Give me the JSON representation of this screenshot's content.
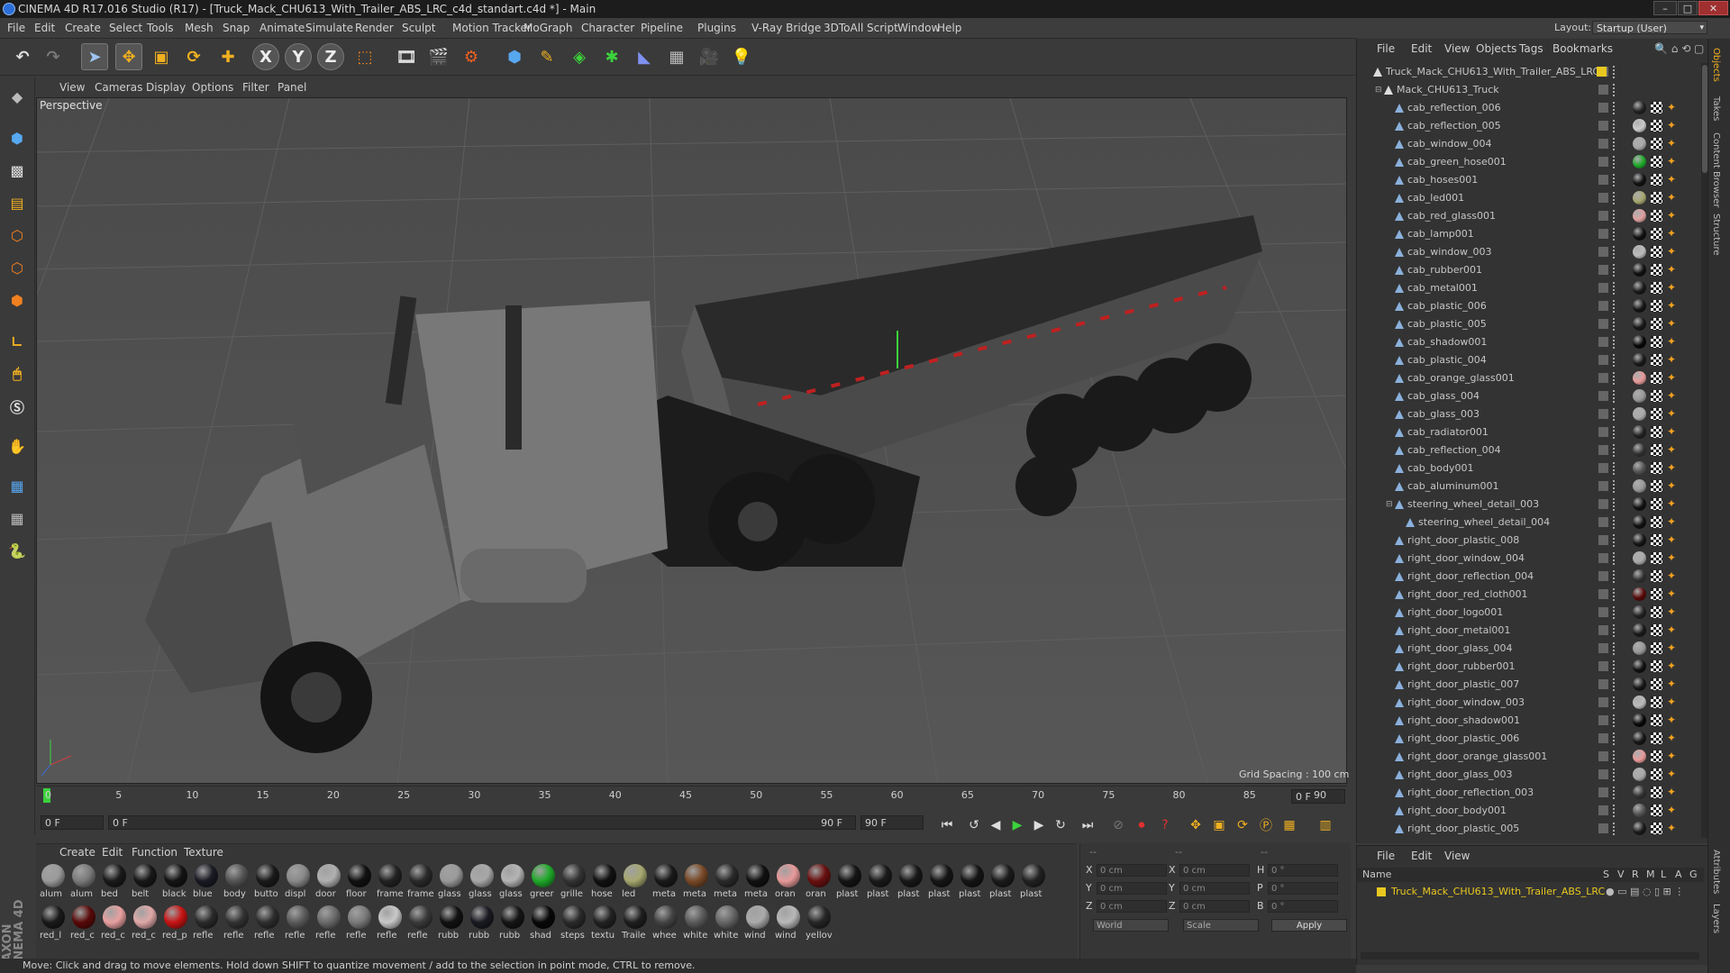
{
  "window": {
    "title": "CINEMA 4D R17.016 Studio (R17) - [Truck_Mack_CHU613_With_Trailer_ABS_LRC_c4d_standart.c4d *] - Main",
    "minimize": "–",
    "maximize": "□",
    "close": "✕"
  },
  "menubar": [
    "File",
    "Edit",
    "Create",
    "Select",
    "Tools",
    "Mesh",
    "Snap",
    "Animate",
    "Simulate",
    "Render",
    "Sculpt",
    "Motion Tracker",
    "MoGraph",
    "Character",
    "Pipeline",
    "Plugins",
    "V-Ray Bridge",
    "3DToAll",
    "Script",
    "Window",
    "Help"
  ],
  "layout": {
    "label": "Layout:",
    "value": "Startup (User)"
  },
  "toolbar": {
    "x": "X",
    "y": "Y",
    "z": "Z"
  },
  "viewport": {
    "menu": [
      "View",
      "Cameras",
      "Display",
      "Options",
      "Filter",
      "Panel"
    ],
    "label": "Perspective",
    "grid_spacing": "Grid Spacing : 100 cm"
  },
  "timeline": {
    "ticks": [
      "0",
      "5",
      "10",
      "15",
      "20",
      "25",
      "30",
      "35",
      "40",
      "45",
      "50",
      "55",
      "60",
      "65",
      "70",
      "75",
      "80",
      "85",
      "90"
    ],
    "current": "0 F",
    "start": "0 F",
    "range_start": "0 F",
    "range_end": "90 F",
    "end": "90 F"
  },
  "materials": {
    "menu": [
      "Create",
      "Edit",
      "Function",
      "Texture"
    ],
    "row1": [
      {
        "label": "alum",
        "color": "#9a9a9a"
      },
      {
        "label": "alum",
        "color": "#7a7a7a"
      },
      {
        "label": "bed",
        "color": "#1a1a1a"
      },
      {
        "label": "belt",
        "color": "#181818"
      },
      {
        "label": "black",
        "color": "#141414"
      },
      {
        "label": "blue",
        "color": "#1a1a24"
      },
      {
        "label": "body",
        "color": "#555"
      },
      {
        "label": "butto",
        "color": "#1a1a1a"
      },
      {
        "label": "displ",
        "color": "#8a8a8a"
      },
      {
        "label": "door",
        "color": "#b0b0b0"
      },
      {
        "label": "floor",
        "color": "#111"
      },
      {
        "label": "frame",
        "color": "#222"
      },
      {
        "label": "frame",
        "color": "#2a2a2a"
      },
      {
        "label": "glass",
        "color": "#9a9a9a"
      },
      {
        "label": "glass",
        "color": "#a8a8a8"
      },
      {
        "label": "glass",
        "color": "#b4b4b4"
      },
      {
        "label": "greer",
        "color": "#1faa2a"
      },
      {
        "label": "grille",
        "color": "#333"
      },
      {
        "label": "hose",
        "color": "#111"
      },
      {
        "label": "led",
        "color": "#a6a870"
      },
      {
        "label": "meta",
        "color": "#1a1a1a"
      },
      {
        "label": "meta",
        "color": "#7a4a28"
      },
      {
        "label": "meta",
        "color": "#2a2a2a"
      },
      {
        "label": "meta",
        "color": "#111"
      },
      {
        "label": "oran",
        "color": "#e89a9a"
      },
      {
        "label": "oran",
        "color": "#6a1010"
      },
      {
        "label": "plast",
        "color": "#141414"
      },
      {
        "label": "plast",
        "color": "#1a1a1a"
      },
      {
        "label": "plast",
        "color": "#181818"
      },
      {
        "label": "plast",
        "color": "#161616"
      },
      {
        "label": "plast",
        "color": "#151515"
      },
      {
        "label": "plast",
        "color": "#1b1b1b"
      },
      {
        "label": "plast",
        "color": "#222"
      }
    ],
    "row2": [
      {
        "label": "red_l",
        "color": "#1a1a1a"
      },
      {
        "label": "red_c",
        "color": "#5a0a0a"
      },
      {
        "label": "red_c",
        "color": "#e8a0a0"
      },
      {
        "label": "red_c",
        "color": "#e0a8a8"
      },
      {
        "label": "red_p",
        "color": "#c81414"
      },
      {
        "label": "refle",
        "color": "#2a2a2a"
      },
      {
        "label": "refle",
        "color": "#333"
      },
      {
        "label": "refle",
        "color": "#2e2e2e"
      },
      {
        "label": "refle",
        "color": "#5a5a5a"
      },
      {
        "label": "refle",
        "color": "#6a6a6a"
      },
      {
        "label": "refle",
        "color": "#7a7a7a"
      },
      {
        "label": "refle",
        "color": "#c8c8c8"
      },
      {
        "label": "refle",
        "color": "#3a3a3a"
      },
      {
        "label": "rubb",
        "color": "#111"
      },
      {
        "label": "rubb",
        "color": "#1a1a22"
      },
      {
        "label": "rubb",
        "color": "#151515"
      },
      {
        "label": "shad",
        "color": "#080808"
      },
      {
        "label": "steps",
        "color": "#2a2a2a"
      },
      {
        "label": "textu",
        "color": "#222"
      },
      {
        "label": "Traile",
        "color": "#1e1e1e"
      },
      {
        "label": "whee",
        "color": "#444"
      },
      {
        "label": "white",
        "color": "#5a5a5a"
      },
      {
        "label": "white",
        "color": "#666"
      },
      {
        "label": "wind",
        "color": "#aaa"
      },
      {
        "label": "wind",
        "color": "#b8b8b8"
      },
      {
        "label": "yellov",
        "color": "#262626"
      }
    ]
  },
  "coords": {
    "header": [
      "--",
      "--",
      "--"
    ],
    "rows": [
      {
        "a": "X",
        "av": "0 cm",
        "b": "X",
        "bv": "0 cm",
        "c": "H",
        "cv": "0 °"
      },
      {
        "a": "Y",
        "av": "0 cm",
        "b": "Y",
        "bv": "0 cm",
        "c": "P",
        "cv": "0 °"
      },
      {
        "a": "Z",
        "av": "0 cm",
        "b": "Z",
        "bv": "0 cm",
        "c": "B",
        "cv": "0 °"
      }
    ],
    "world": "World",
    "scale": "Scale",
    "apply": "Apply"
  },
  "objects": {
    "menu": [
      "File",
      "Edit",
      "View",
      "Objects",
      "Tags",
      "Bookmarks"
    ],
    "root": "Truck_Mack_CHU613_With_Trailer_ABS_LRC",
    "group": "Mack_CHU613_Truck",
    "items": [
      {
        "name": "cab_reflection_006",
        "indent": 1,
        "mat": "#222"
      },
      {
        "name": "cab_reflection_005",
        "indent": 1,
        "mat": "#ccc"
      },
      {
        "name": "cab_window_004",
        "indent": 1,
        "mat": "#aaa"
      },
      {
        "name": "cab_green_hose001",
        "indent": 1,
        "mat": "#1faa2a"
      },
      {
        "name": "cab_hoses001",
        "indent": 1,
        "mat": "#111"
      },
      {
        "name": "cab_led001",
        "indent": 1,
        "mat": "#a6a870"
      },
      {
        "name": "cab_red_glass001",
        "indent": 1,
        "mat": "#e0a0a0"
      },
      {
        "name": "cab_lamp001",
        "indent": 1,
        "mat": "#111"
      },
      {
        "name": "cab_window_003",
        "indent": 1,
        "mat": "#bbb"
      },
      {
        "name": "cab_rubber001",
        "indent": 1,
        "mat": "#111"
      },
      {
        "name": "cab_metal001",
        "indent": 1,
        "mat": "#1a1a1a"
      },
      {
        "name": "cab_plastic_006",
        "indent": 1,
        "mat": "#151515"
      },
      {
        "name": "cab_plastic_005",
        "indent": 1,
        "mat": "#181818"
      },
      {
        "name": "cab_shadow001",
        "indent": 1,
        "mat": "#080808"
      },
      {
        "name": "cab_plastic_004",
        "indent": 1,
        "mat": "#1a1a1a"
      },
      {
        "name": "cab_orange_glass001",
        "indent": 1,
        "mat": "#e89a9a"
      },
      {
        "name": "cab_glass_004",
        "indent": 1,
        "mat": "#999"
      },
      {
        "name": "cab_glass_003",
        "indent": 1,
        "mat": "#aaa"
      },
      {
        "name": "cab_radiator001",
        "indent": 1,
        "mat": "#222"
      },
      {
        "name": "cab_reflection_004",
        "indent": 1,
        "mat": "#333"
      },
      {
        "name": "cab_body001",
        "indent": 1,
        "mat": "#555"
      },
      {
        "name": "cab_aluminum001",
        "indent": 1,
        "mat": "#999"
      },
      {
        "name": "steering_wheel_detail_003",
        "indent": 1,
        "mat": "#111",
        "expand": true
      },
      {
        "name": "steering_wheel_detail_004",
        "indent": 2,
        "mat": "#111"
      },
      {
        "name": "right_door_plastic_008",
        "indent": 1,
        "mat": "#151515"
      },
      {
        "name": "right_door_window_004",
        "indent": 1,
        "mat": "#aaa"
      },
      {
        "name": "right_door_reflection_004",
        "indent": 1,
        "mat": "#333"
      },
      {
        "name": "right_door_red_cloth001",
        "indent": 1,
        "mat": "#5a0a0a"
      },
      {
        "name": "right_door_logo001",
        "indent": 1,
        "mat": "#222"
      },
      {
        "name": "right_door_metal001",
        "indent": 1,
        "mat": "#1a1a1a"
      },
      {
        "name": "right_door_glass_004",
        "indent": 1,
        "mat": "#999"
      },
      {
        "name": "right_door_rubber001",
        "indent": 1,
        "mat": "#111"
      },
      {
        "name": "right_door_plastic_007",
        "indent": 1,
        "mat": "#161616"
      },
      {
        "name": "right_door_window_003",
        "indent": 1,
        "mat": "#bbb"
      },
      {
        "name": "right_door_shadow001",
        "indent": 1,
        "mat": "#080808"
      },
      {
        "name": "right_door_plastic_006",
        "indent": 1,
        "mat": "#151515"
      },
      {
        "name": "right_door_orange_glass001",
        "indent": 1,
        "mat": "#e89a9a"
      },
      {
        "name": "right_door_glass_003",
        "indent": 1,
        "mat": "#aaa"
      },
      {
        "name": "right_door_reflection_003",
        "indent": 1,
        "mat": "#333"
      },
      {
        "name": "right_door_body001",
        "indent": 1,
        "mat": "#555"
      },
      {
        "name": "right_door_plastic_005",
        "indent": 1,
        "mat": "#1a1a1a"
      }
    ]
  },
  "attributes": {
    "menu": [
      "File",
      "Edit",
      "View"
    ],
    "header_name": "Name",
    "header_cols": [
      "S",
      "V",
      "R",
      "M",
      "L",
      "A",
      "G"
    ],
    "item": "Truck_Mack_CHU613_With_Trailer_ABS_LRC"
  },
  "right_tabs": [
    "Objects",
    "Takes",
    "Content Browser",
    "Structure",
    "Attributes",
    "Layers"
  ],
  "brand": "MAXON CINEMA 4D",
  "status": "Move: Click and drag to move elements. Hold down SHIFT to quantize movement / add to the selection in point mode, CTRL to remove.",
  "colors": {
    "accent_yellow": "#e8c820",
    "object_blue": "#8ab0dc",
    "play_green": "#3cd23c"
  }
}
